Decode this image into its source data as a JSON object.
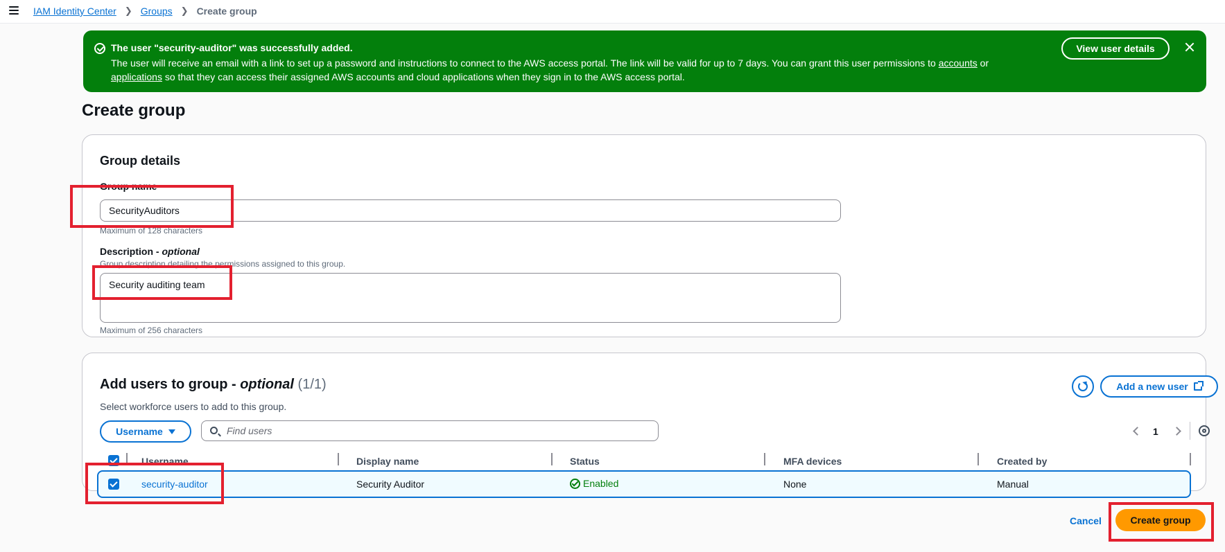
{
  "breadcrumb": {
    "items": [
      "IAM Identity Center",
      "Groups"
    ],
    "current": "Create group"
  },
  "flash": {
    "title": "The user \"security-auditor\" was successfully added.",
    "body_part1": "The user will receive an email with a link to set up a password and instructions to connect to the AWS access portal. The link will be valid for up to 7 days. You can grant this user permissions to ",
    "link_accounts": "accounts",
    "body_part2": " or ",
    "link_applications": "applications",
    "body_part3": " so that they can access their assigned AWS accounts and cloud applications when they sign in to the AWS access portal.",
    "button": "View user details",
    "color": "#037f0c"
  },
  "page": {
    "title": "Create group"
  },
  "group_details": {
    "heading": "Group details",
    "name_label": "Group name",
    "name_value": "SecurityAuditors",
    "name_hint": "Maximum of 128 characters",
    "desc_label": "Description - ",
    "desc_label_optional": "optional",
    "desc_hint_top": "Group description detailing the permissions assigned to this group.",
    "desc_value": "Security auditing team",
    "desc_hint": "Maximum of 256 characters"
  },
  "add_users": {
    "heading": "Add users to group - ",
    "heading_optional": "optional",
    "counter": "(1/1)",
    "subtitle": "Select workforce users to add to this group.",
    "add_new_user": "Add a new user",
    "filter_property": "Username",
    "search_placeholder": "Find users",
    "page_number": "1",
    "columns": [
      "Username",
      "Display name",
      "Status",
      "MFA devices",
      "Created by"
    ],
    "rows": [
      {
        "username": "security-auditor",
        "display_name": "Security Auditor",
        "status": "Enabled",
        "mfa": "None",
        "created_by": "Manual"
      }
    ]
  },
  "actions": {
    "cancel": "Cancel",
    "create": "Create group"
  },
  "colors": {
    "accent": "#0972d3",
    "primary": "#ff9900",
    "success": "#037f0c",
    "highlight": "#e3202f"
  },
  "icons": [
    "menu-icon",
    "chevron-right-icon",
    "success-icon",
    "close-icon",
    "refresh-icon",
    "external-link-icon",
    "caret-down-icon",
    "search-icon",
    "chevron-left-icon",
    "gear-icon",
    "checkbox-icon"
  ]
}
